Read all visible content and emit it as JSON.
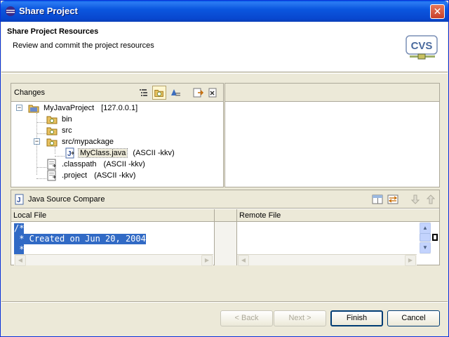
{
  "window": {
    "title": "Share Project",
    "close_glyph": "✕"
  },
  "header": {
    "title": "Share Project Resources",
    "description": "Review and commit the project resources",
    "logo_text": "CVS"
  },
  "changes": {
    "label": "Changes",
    "tree": [
      {
        "label": "MyJavaProject",
        "extra": "[127.0.0.1]",
        "icon": "project-folder-icon"
      },
      {
        "label": "bin",
        "extra": "",
        "icon": "folder-icon"
      },
      {
        "label": "src",
        "extra": "",
        "icon": "folder-icon"
      },
      {
        "label": "src/mypackage",
        "extra": "",
        "icon": "folder-icon"
      },
      {
        "label": "MyClass.java",
        "extra": "(ASCII -kkv)",
        "icon": "java-file-icon"
      },
      {
        "label": ".classpath",
        "extra": "(ASCII -kkv)",
        "icon": "file-icon"
      },
      {
        "label": ".project",
        "extra": "(ASCII -kkv)",
        "icon": "file-icon"
      }
    ]
  },
  "compare": {
    "label": "Java Source Compare",
    "local_header": "Local File",
    "remote_header": "Remote File",
    "code_lines": [
      "/*",
      " * Created on Jun 20, 2004",
      " *"
    ]
  },
  "buttons": {
    "back": "< Back",
    "next": "Next >",
    "finish": "Finish",
    "cancel": "Cancel"
  },
  "colors": {
    "title_bar": "#0a5ce8",
    "selection": "#316ac5",
    "dialog_bg": "#ece9d8"
  }
}
